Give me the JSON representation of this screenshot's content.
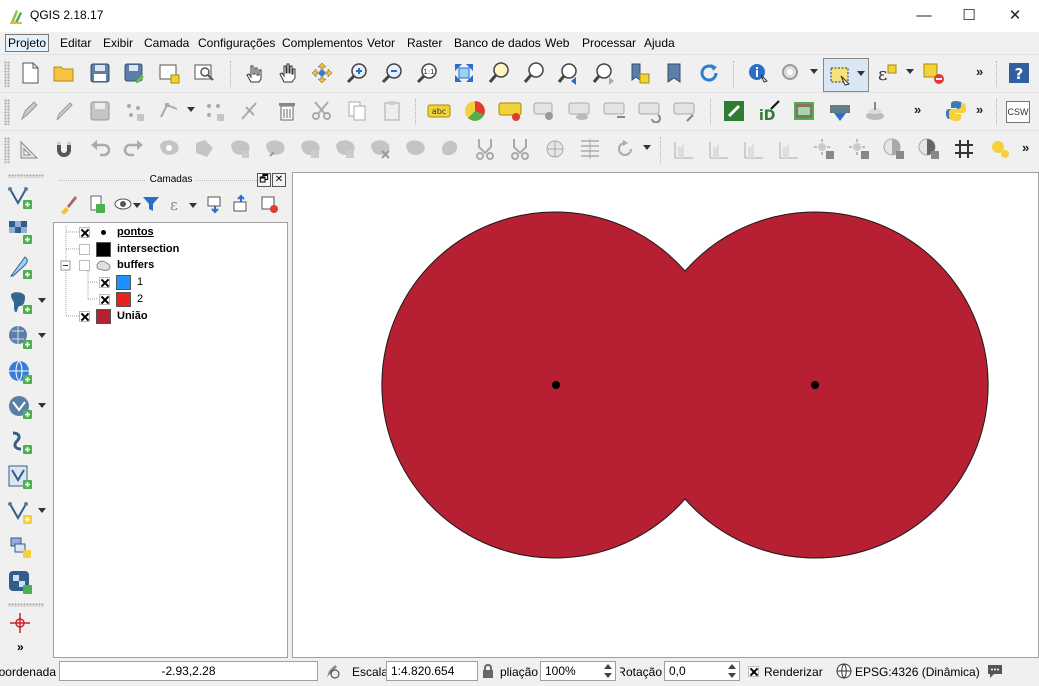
{
  "window": {
    "title": "QGIS 2.18.17",
    "minimize": "—",
    "maximize": "☐",
    "close": "✕"
  },
  "menu": [
    "Projeto",
    "Editar",
    "Exibir",
    "Camada",
    "Configurações",
    "Complementos",
    "Vetor",
    "Raster",
    "Banco de dados",
    "Web",
    "Processar",
    "Ajuda"
  ],
  "toolbar": {
    "abc_label": "abc",
    "csw_label": "CSW",
    "more": "»",
    "scale_1_1": "1:1"
  },
  "layers_panel": {
    "title": "Camadas",
    "float_btn": "🗗",
    "close_btn": "✕",
    "layers": [
      {
        "name": "pontos",
        "checked": true,
        "symbol": "point",
        "indent": 0
      },
      {
        "name": "intersection",
        "checked": false,
        "symbol": "#000000",
        "indent": 0
      },
      {
        "name": "buffers",
        "checked": false,
        "symbol": "group",
        "indent": 0
      },
      {
        "name": "1",
        "checked": true,
        "symbol": "#1e90ff",
        "indent": 1
      },
      {
        "name": "2",
        "checked": true,
        "symbol": "#e8221f",
        "indent": 1
      },
      {
        "name": "União",
        "checked": true,
        "symbol": "#b71f33",
        "indent": 0
      }
    ]
  },
  "map": {
    "fill_color": "#b71f33",
    "outline_color": "#1a1a1a",
    "point_color": "#000000"
  },
  "statusbar": {
    "coordinate_label": "Coordenada",
    "coordinate_value": "-2.93,2.28",
    "scale_label": "Escala",
    "scale_value": "1:4.820.654",
    "magnifier_label": "Ampliação",
    "magnifier_value": "100%",
    "rotation_label": "Rotação",
    "rotation_value": "0,0",
    "render_label": "Renderizar",
    "render_checked": true,
    "crs_label": "EPSG:4326 (Dinâmica)"
  }
}
